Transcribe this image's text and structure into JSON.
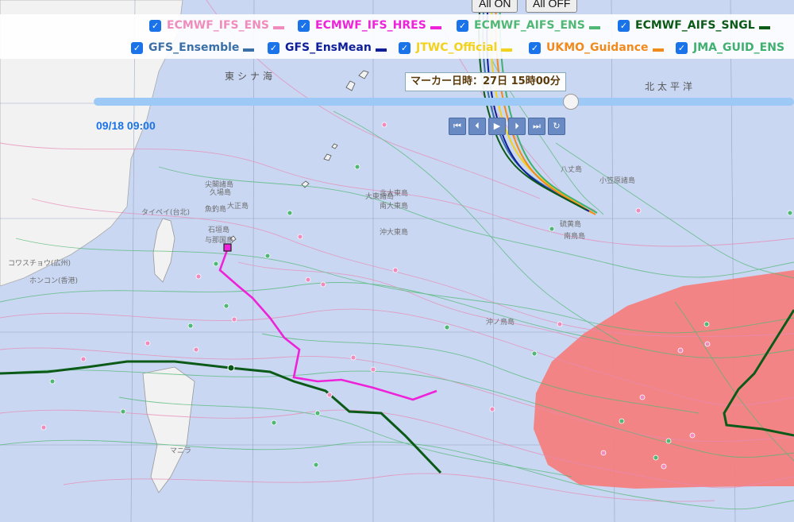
{
  "top_buttons": {
    "all_on": "All ON",
    "all_off": "All OFF"
  },
  "legend": [
    {
      "label": "ECMWF_IFS_ENS",
      "color": "#f08cbd",
      "checked": true
    },
    {
      "label": "ECMWF_IFS_HRES",
      "color": "#ee22d8",
      "checked": true
    },
    {
      "label": "ECMWF_AIFS_ENS",
      "color": "#50b874",
      "checked": true
    },
    {
      "label": "ECMWF_AIFS_SNGL",
      "color": "#0c5a18",
      "checked": true
    },
    {
      "label": "GFS_Ensemble",
      "color": "#3a6fa8",
      "checked": true
    },
    {
      "label": "GFS_EnsMean",
      "color": "#0f1f9a",
      "checked": true
    },
    {
      "label": "JTWC_Official",
      "color": "#f2d21a",
      "checked": true
    },
    {
      "label": "UKMO_Guidance",
      "color": "#f08a1c",
      "checked": true
    },
    {
      "label": "JMA_GUID_ENS",
      "color": "#40b070",
      "checked": true
    }
  ],
  "marker_time": "マーカー日時：27日 15時00分",
  "start_time": "09/18 09:00",
  "slider_position": 0.68,
  "playback_controls": [
    "first-icon",
    "prev-icon",
    "play-icon",
    "next-icon",
    "last-icon",
    "loop-icon"
  ],
  "map": {
    "sea_labels": [
      "東シナ海",
      "北太平洋"
    ],
    "place_labels": [
      "ホンコン(香港)",
      "コワスチョウ(広州)",
      "タイペイ(台北)",
      "マニラ",
      "沖ノ鳥島",
      "南鳥島",
      "小笠原諸島",
      "硫黄島",
      "尖閣諸島",
      "魚釣島",
      "久場島",
      "大正島",
      "与那国島",
      "石垣島",
      "八丈島",
      "大東諸島",
      "北大東島",
      "南大東島",
      "沖大東島"
    ]
  },
  "colors": {
    "sea": "#c9d7f2",
    "land": "#f2f2f2",
    "risk_area": "#f47f7f"
  }
}
